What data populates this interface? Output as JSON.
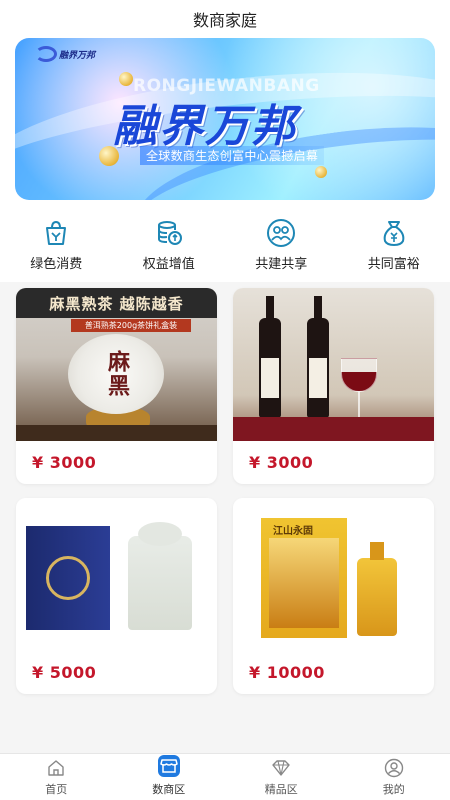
{
  "header": {
    "title": "数商家庭"
  },
  "banner": {
    "logo_text": "融界万邦",
    "english": "RONGJIEWANBANG",
    "headline": "融界万邦",
    "subtitle": "全球数商生态创富中心震撼启幕"
  },
  "features": [
    {
      "label": "绿色消费",
      "icon": "shopping-bag-icon"
    },
    {
      "label": "权益增值",
      "icon": "coin-stack-icon"
    },
    {
      "label": "共建共享",
      "icon": "people-icon"
    },
    {
      "label": "共同富裕",
      "icon": "money-bag-icon"
    }
  ],
  "products": [
    {
      "price": "¥ 3000",
      "banner_text": "麻黑熟茶 越陈越香",
      "ribbon": "普洱熟茶200g茶饼礼盒装",
      "seal": "麻黑"
    },
    {
      "price": "¥ 3000"
    },
    {
      "price": "¥ 5000"
    },
    {
      "price": "¥ 10000",
      "label": "江山永固"
    }
  ],
  "tabs": [
    {
      "label": "首页",
      "icon": "home-icon"
    },
    {
      "label": "数商区",
      "icon": "shop-icon",
      "active": true
    },
    {
      "label": "精品区",
      "icon": "diamond-icon"
    },
    {
      "label": "我的",
      "icon": "user-icon"
    }
  ],
  "colors": {
    "accent": "#1f7ae0",
    "price": "#c4172b",
    "icon": "#1e87b5"
  }
}
